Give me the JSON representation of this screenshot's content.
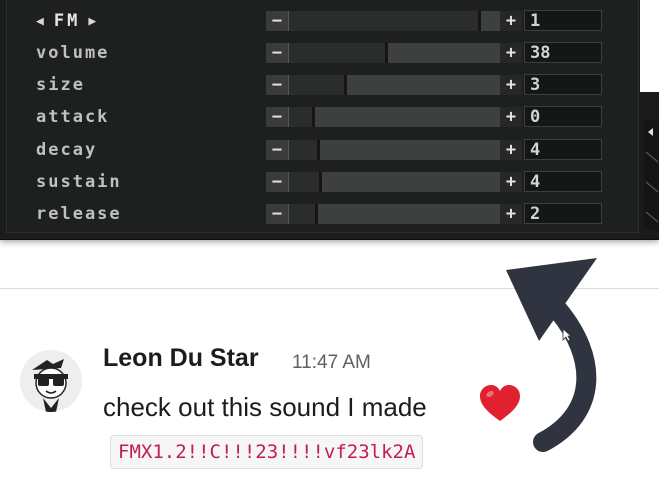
{
  "synth": {
    "mode": {
      "prev_arrow": "◀",
      "label": "FM",
      "next_arrow": "▶",
      "value": "1",
      "level": 0.9
    },
    "params": [
      {
        "label": "volume",
        "value": "38",
        "level": 0.46
      },
      {
        "label": "size",
        "value": "3",
        "level": 0.27
      },
      {
        "label": "attack",
        "value": "0",
        "level": 0.12
      },
      {
        "label": "decay",
        "value": "4",
        "level": 0.14
      },
      {
        "label": "sustain",
        "value": "4",
        "level": 0.15
      },
      {
        "label": "release",
        "value": "2",
        "level": 0.13
      }
    ],
    "minus": "−",
    "plus": "+"
  },
  "message": {
    "author": "Leon Du Star",
    "time": "11:47 AM",
    "text": "check out this sound I made",
    "code": "FMX1.2!!C!!!23!!!!vf23lk2A"
  },
  "colors": {
    "heart": "#e0212f",
    "code_text": "#c21e56",
    "arrow": "#2f3440"
  },
  "icons": [
    "arrow-left-icon",
    "arrow-right-icon",
    "heart-emoji-icon",
    "curved-arrow-icon",
    "avatar-image",
    "cursor-icon"
  ]
}
